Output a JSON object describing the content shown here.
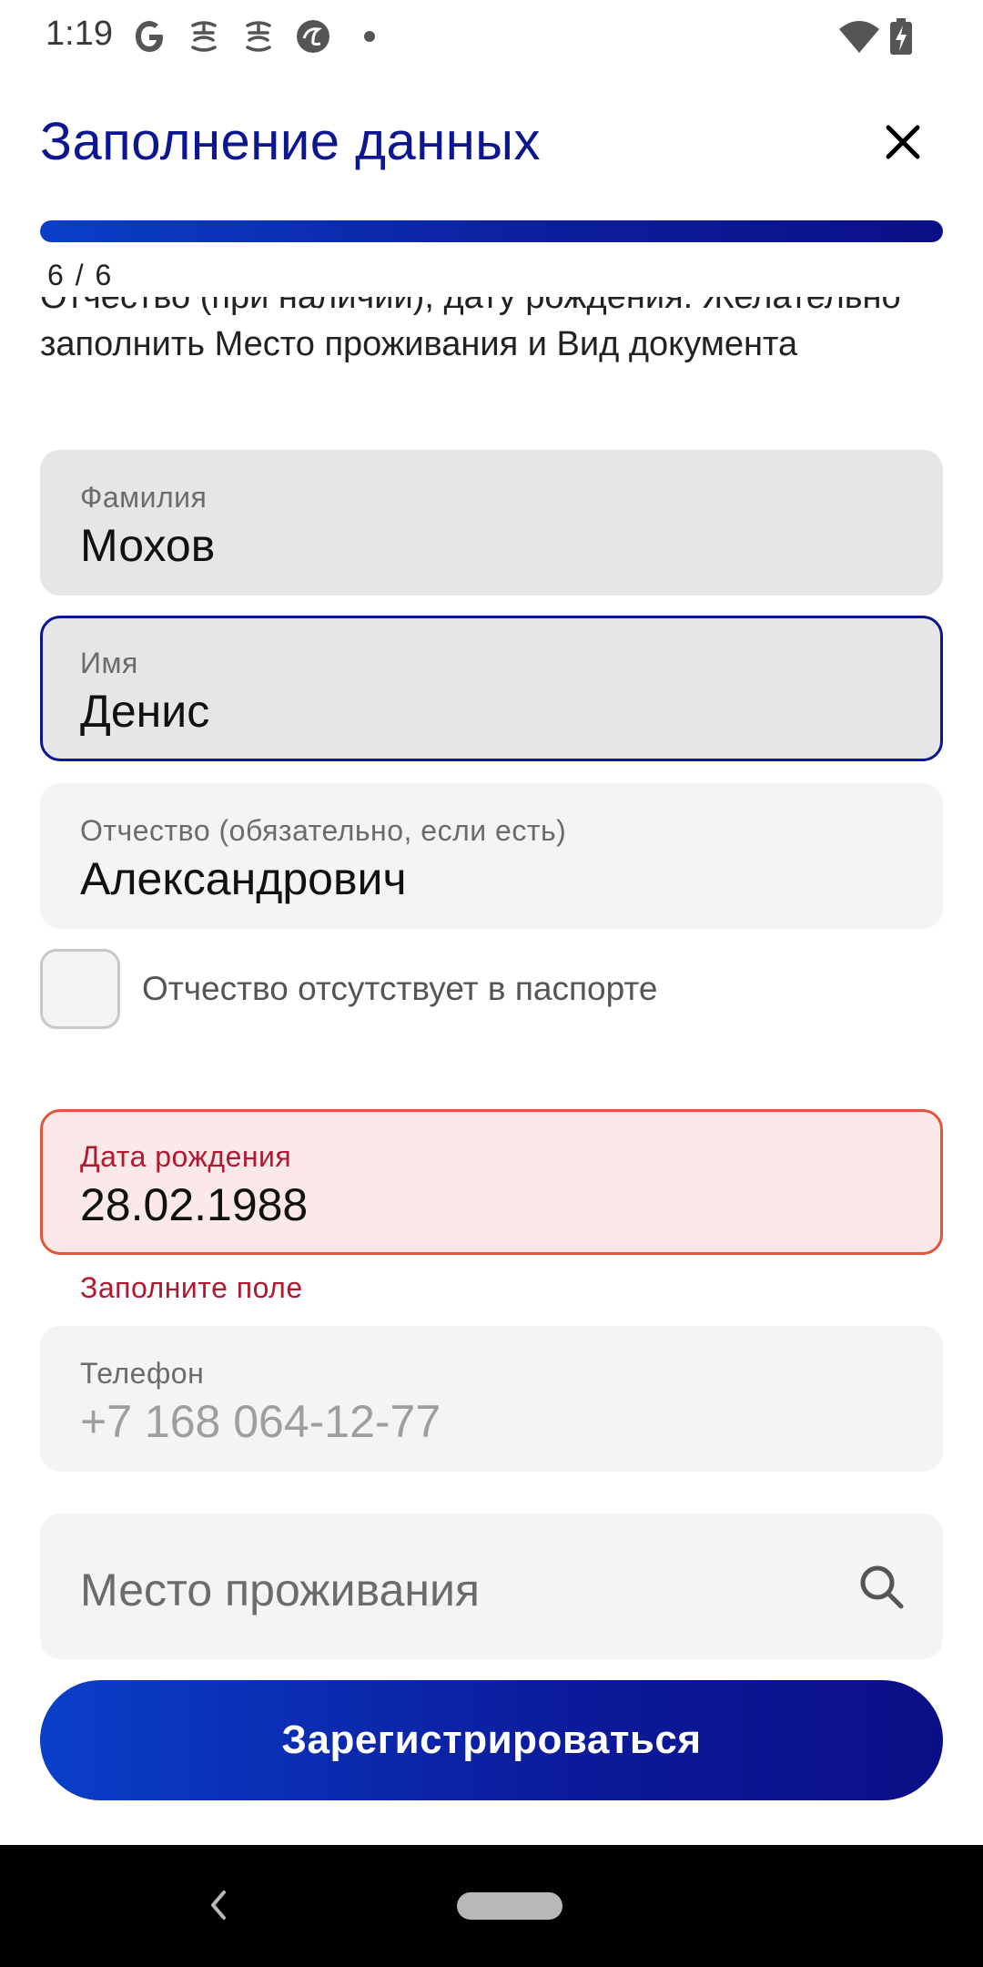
{
  "status_bar": {
    "time": "1:19",
    "icons": [
      "google-icon",
      "app-icon",
      "app-icon",
      "browser-icon",
      "dot-icon",
      "wifi-icon",
      "battery-charging-icon"
    ]
  },
  "header": {
    "title": "Заполнение данных",
    "close_icon": "close-icon"
  },
  "progress": {
    "current": 6,
    "total": 6,
    "fraction": 1.0,
    "text": "6 / 6"
  },
  "form": {
    "hint": "Отчество (при наличии), дату рождения. Желательно заполнить Место проживания и Вид документа",
    "last_name": {
      "label": "Фамилия",
      "value": "Мохов"
    },
    "first_name": {
      "label": "Имя",
      "value": "Денис"
    },
    "patronymic": {
      "label": "Отчество (обязательно, если есть)",
      "value": "Александрович"
    },
    "no_patronymic_checkbox": {
      "label": "Отчество отсутствует в паспорте",
      "checked": false
    },
    "birth_date": {
      "label": "Дата рождения",
      "value": "28.02.1988",
      "error": "Заполните поле"
    },
    "phone": {
      "label": "Телефон",
      "value": "+7 168 064-12-77"
    },
    "address": {
      "placeholder": "Место проживания",
      "icon": "search-icon"
    }
  },
  "register_button": {
    "label": "Зарегистрироваться"
  },
  "colors": {
    "brand_dark": "#0d1691",
    "brand_blue": "#0a3fc9",
    "error_red": "#b0192f",
    "error_border": "#e2553a"
  }
}
